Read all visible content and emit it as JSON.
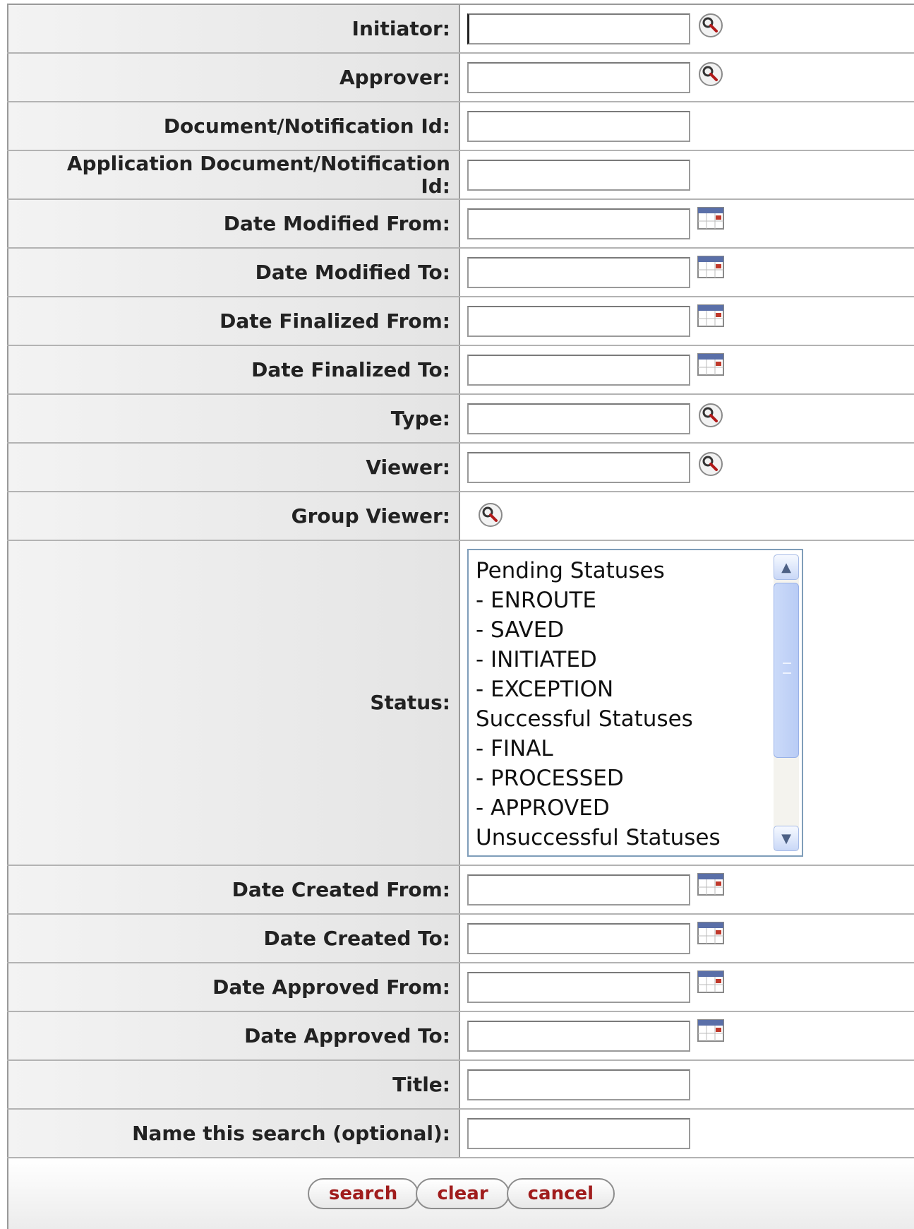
{
  "form": {
    "rows": [
      {
        "label": "Initiator:",
        "value": "",
        "control": "input",
        "icon": "search-icon"
      },
      {
        "label": "Approver:",
        "value": "",
        "control": "input",
        "icon": "search-icon"
      },
      {
        "label": "Document/Notification Id:",
        "value": "",
        "control": "input",
        "icon": ""
      },
      {
        "label_lines": [
          "Application Document/Notification",
          "Id:"
        ],
        "value": "",
        "control": "input",
        "icon": ""
      },
      {
        "label": "Date Modified From:",
        "value": "",
        "control": "input",
        "icon": "calendar-icon"
      },
      {
        "label": "Date Modified To:",
        "value": "",
        "control": "input",
        "icon": "calendar-icon"
      },
      {
        "label": "Date Finalized From:",
        "value": "",
        "control": "input",
        "icon": "calendar-icon"
      },
      {
        "label": "Date Finalized To:",
        "value": "",
        "control": "input",
        "icon": "calendar-icon"
      },
      {
        "label": "Type:",
        "value": "",
        "control": "input",
        "icon": "search-icon"
      },
      {
        "label": "Viewer:",
        "value": "",
        "control": "input",
        "icon": "search-icon"
      },
      {
        "label": "Group Viewer:",
        "control": "none",
        "icon": "search-icon"
      },
      {
        "label": "Status:",
        "control": "listbox"
      },
      {
        "label": "Date Created From:",
        "value": "",
        "control": "input",
        "icon": "calendar-icon"
      },
      {
        "label": "Date Created To:",
        "value": "",
        "control": "input",
        "icon": "calendar-icon"
      },
      {
        "label": "Date Approved From:",
        "value": "",
        "control": "input",
        "icon": "calendar-icon"
      },
      {
        "label": "Date Approved To:",
        "value": "",
        "control": "input",
        "icon": "calendar-icon"
      },
      {
        "label": "Title:",
        "value": "",
        "control": "input",
        "icon": ""
      },
      {
        "label": "Name this search (optional):",
        "value": "",
        "control": "input",
        "icon": ""
      }
    ],
    "status_options": [
      "Pending Statuses",
      "- ENROUTE",
      "- SAVED",
      "- INITIATED",
      "- EXCEPTION",
      "Successful Statuses",
      "- FINAL",
      "- PROCESSED",
      "- APPROVED",
      "Unsuccessful Statuses"
    ],
    "buttons": {
      "search": "search",
      "clear": "clear",
      "cancel": "cancel"
    }
  },
  "colors": {
    "button_text": "#a01c1c",
    "label_bg": "#e8e8e8",
    "listbox_border": "#7f9db9"
  }
}
